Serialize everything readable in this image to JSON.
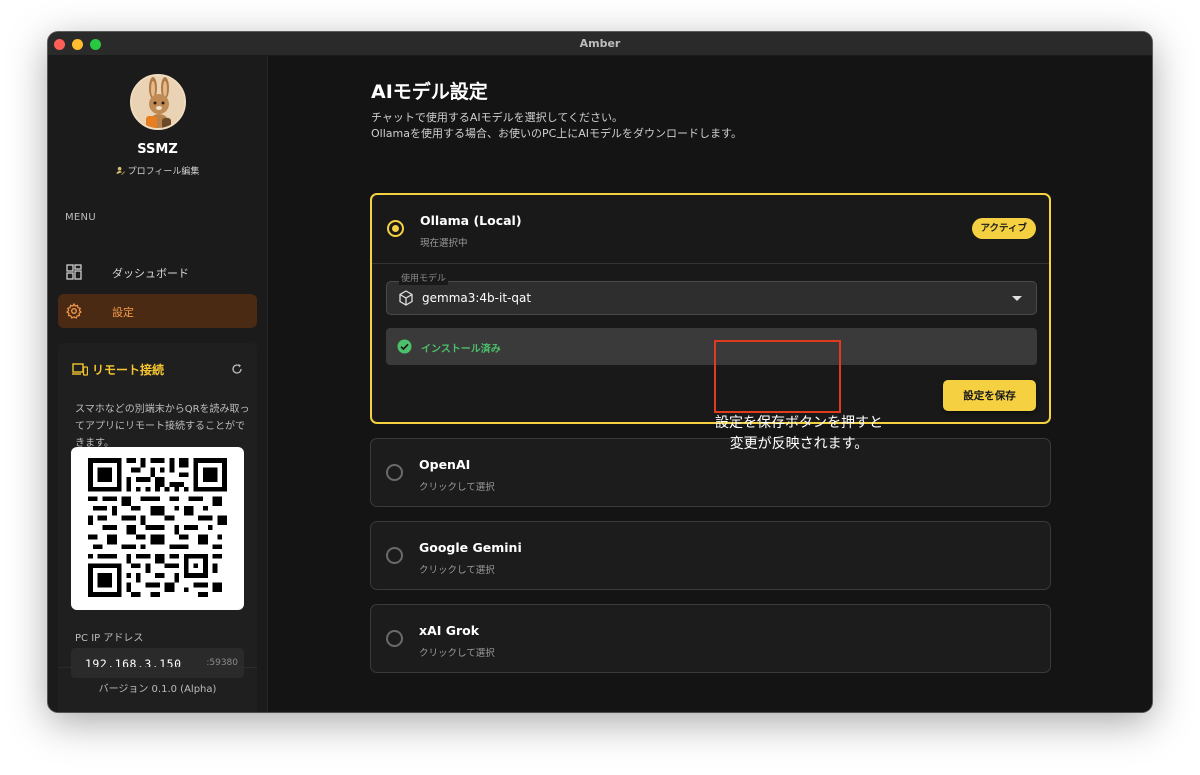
{
  "window": {
    "title": "Amber"
  },
  "sidebar": {
    "user_name": "SSMZ",
    "profile_edit": "プロフィール編集",
    "menu_label": "MENU",
    "nav": [
      {
        "label": "ダッシュボード",
        "icon": "dashboard-icon",
        "active": false
      },
      {
        "label": "設定",
        "icon": "gear-icon",
        "active": true
      }
    ],
    "remote": {
      "title": "リモート接続",
      "description": "スマホなどの別端末からQRを読み取ってアプリにリモート接続することができます。",
      "ip_label": "PC IP アドレス",
      "ip": "192.168.3.150",
      "port": ":59380"
    },
    "version": "バージョン 0.1.0 (Alpha)"
  },
  "main": {
    "title": "AIモデル設定",
    "description_line1": "チャットで使用するAIモデルを選択してください。",
    "description_line2": "Ollamaを使用する場合、お使いのPC上にAIモデルをダウンロードします。",
    "providers": [
      {
        "name": "Ollama (Local)",
        "status": "現在選択中",
        "badge": "アクティブ",
        "selected": true
      },
      {
        "name": "OpenAI",
        "status": "クリックして選択",
        "selected": false
      },
      {
        "name": "Google Gemini",
        "status": "クリックして選択",
        "selected": false
      },
      {
        "name": "xAI Grok",
        "status": "クリックして選択",
        "selected": false
      }
    ],
    "model_legend": "使用モデル",
    "model_value": "gemma3:4b-it-qat",
    "installed_label": "インストール済み",
    "save_button": "設定を保存"
  },
  "annotation": {
    "line1": "設定を保存ボタンを押すと",
    "line2": "変更が反映されます。"
  },
  "colors": {
    "accent": "#f5d142",
    "nav_active_bg": "#4a2a13",
    "nav_active_text": "#f39a4b",
    "installed": "#4cc06a",
    "annotation": "#e03a1f"
  }
}
